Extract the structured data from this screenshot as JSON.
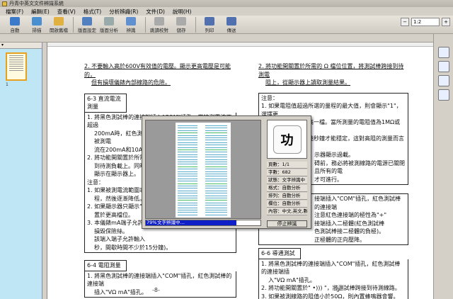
{
  "window": {
    "title": "丹青中英文文件辨識系統"
  },
  "menu": [
    "檔案(F)",
    "編輯(E)",
    "查看(V)",
    "格式(T)",
    "分析辨識(R)",
    "文件(D)",
    "說明(H)"
  ],
  "toolbar": {
    "buttons": [
      {
        "label": "自動",
        "icon": "auto-icon",
        "color": "#3a7ac8"
      },
      {
        "label": "掃描",
        "icon": "scanner-icon",
        "color": "#4a90d0"
      },
      {
        "label": "開啟舊檔",
        "icon": "open-folder-icon",
        "color": "#e0b040"
      },
      {
        "label": "版面設定",
        "icon": "layout-icon",
        "color": "#5080c0"
      },
      {
        "label": "版面分析",
        "icon": "analyze-icon",
        "color": "#9aa"
      },
      {
        "label": "辨識",
        "icon": "recognize-icon",
        "color": "#6090d0"
      },
      {
        "label": "跳讀校對",
        "icon": "proofread-icon",
        "color": "#aaa"
      },
      {
        "label": "儲存",
        "icon": "save-icon",
        "color": "#aaa"
      },
      {
        "label": "列印",
        "icon": "print-icon",
        "color": "#5070b0"
      },
      {
        "label": "傳送",
        "icon": "send-icon",
        "color": "#5070b0"
      }
    ],
    "zoom": "1:2"
  },
  "thumbnail": {
    "page_label": "1"
  },
  "document": {
    "left_col": {
      "p2": "2. 不要輸入高於600V有效值的電壓。顯示更高電壓是可能的，",
      "p2b": "但有損壞儀錶內部線路的危險。",
      "h63": "6-3 直流電流測量",
      "l1": "1. 將黑色測試棒的連接端插入\"COM\"插孔，當被測電流不超過",
      "l1b": "200mA時，紅色測試棒的連接端插入\"mA\"插孔，如果被測電",
      "l1c": "流在200mA和10A之間",
      "l2": "2. 將功能開關置於所需",
      "l2b": "到待測負載上。同時",
      "l2c": "顯示在顯示器上。",
      "note": "注意：",
      "n1": "1. 如果被測電流範圍事",
      "n1b": "程，然後逐漸降低。",
      "n2": "2. 如果顯示器只顯示\"1\"",
      "n2b": "置於更高檔位。",
      "n3": "3. 本儀錶mA端子允許輸",
      "n3b": "損毀保險絲。",
      "n3c": "該端入端子允許輸入",
      "n3d": "秒，間歇時間不少於15分鐘)。",
      "h64": "6-4 電阻測量",
      "r1": "1. 將黑色測試棒的連接端插入\"COM\"插孔，紅色測試棒的連接端",
      "r1b": "插入\"VΩ mA\"插孔。",
      "page": "-8-"
    },
    "right_col": {
      "p2": "2. 將功能開關置於所需的 Ω 檔位位置，將測試棒跨接到待測電",
      "p2b": "阻上，從顯示器上讀取測量結果。",
      "note": "注意：",
      "n1": "1. 如果電阻值超過所選的量程的最大值，則會顯示\"1\"，選擇更",
      "n1b": "將功能開關轉到高一檔。當所測量的電阻值為1MΩ或1MΩ以",
      "n1c": "上時，讀數需要幾秒鐘才能穩定，這對高阻的測量而言是正",
      "n2": "示器顯示過載。",
      "n3": "碍前，務必將被測線路的電源已關閉且所有的電",
      "n3b": "才可進行。",
      "d1": "接端插入\"COM\"插孔，紅色測試棒的連接端",
      "d1b": "注意紅色連接端的極性為\"+\"",
      "d2": "接端插入二極體(紅色測試棒",
      "d2b": "將測試棒跨接到待測二極體(紅色測試棒",
      "d2c": "色測試棒接二極體的負極)。",
      "d2d": "正極體的正向壓降。",
      "h66": "6-6 導通測試",
      "c1": "1. 將黑色測試棒的連接端插入\"COM\"插孔，紅色測試棒的連接端插",
      "c1b": "入\"VΩ mA\"插孔。",
      "c2": "2. 將功能開關置於\" •))) \"，將測試棒跨接到待測線路。",
      "c3": "3. 如果被測線路的阻值小於50Ω，則內置蜂鳴器會響。",
      "page": "-9-"
    }
  },
  "ocr_dialog": {
    "current_char": "功",
    "info": [
      "頁數：1/1",
      "字數：682",
      "狀態：文字辨識中",
      "格式：自動分析",
      "排列：自動分析",
      "欄位：自動分析",
      "內容：中文,英文,數字"
    ],
    "progress_pct": "79%",
    "progress_value": 0.79,
    "progress_label": "文字辨識中…",
    "stop_button": "停止辨識"
  }
}
